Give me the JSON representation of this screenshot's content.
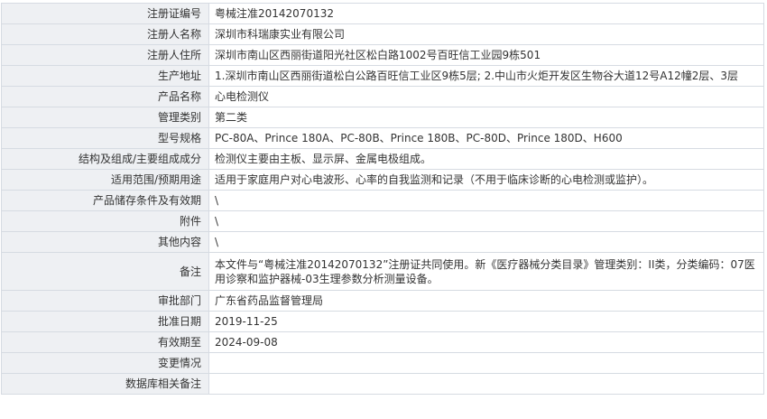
{
  "rows": [
    {
      "label": "注册证编号",
      "value": "粤械注准20142070132"
    },
    {
      "label": "注册人名称",
      "value": "深圳市科瑞康实业有限公司"
    },
    {
      "label": "注册人住所",
      "value": "深圳市南山区西丽街道阳光社区松白路1002号百旺信工业园9栋501"
    },
    {
      "label": "生产地址",
      "value": "1.深圳市南山区西丽街道松白公路百旺信工业区9栋5层; 2.中山市火炬开发区生物谷大道12号A12幢2层、3层"
    },
    {
      "label": "产品名称",
      "value": "心电检测仪"
    },
    {
      "label": "管理类别",
      "value": "第二类"
    },
    {
      "label": "型号规格",
      "value": "PC-80A、Prince 180A、PC-80B、Prince 180B、PC-80D、Prince 180D、H600"
    },
    {
      "label": "结构及组成/主要组成成分",
      "value": "检测仪主要由主板、显示屏、金属电极组成。"
    },
    {
      "label": "适用范围/预期用途",
      "value": "适用于家庭用户对心电波形、心率的自我监测和记录（不用于临床诊断的心电检测或监护）。"
    },
    {
      "label": "产品储存条件及有效期",
      "value": "\\"
    },
    {
      "label": "附件",
      "value": "\\"
    },
    {
      "label": "其他内容",
      "value": "\\"
    },
    {
      "label": "备注",
      "value": "本文件与“粤械注准20142070132”注册证共同使用。新《医疗器械分类目录》管理类别：II类，分类编码：07医用诊察和监护器械-03生理参数分析测量设备。"
    },
    {
      "label": "审批部门",
      "value": "广东省药品监督管理局"
    },
    {
      "label": "批准日期",
      "value": "2019-11-25"
    },
    {
      "label": "有效期至",
      "value": "2024-09-08"
    },
    {
      "label": "变更情况",
      "value": ""
    },
    {
      "label": "数据库相关备注",
      "value": ""
    }
  ]
}
